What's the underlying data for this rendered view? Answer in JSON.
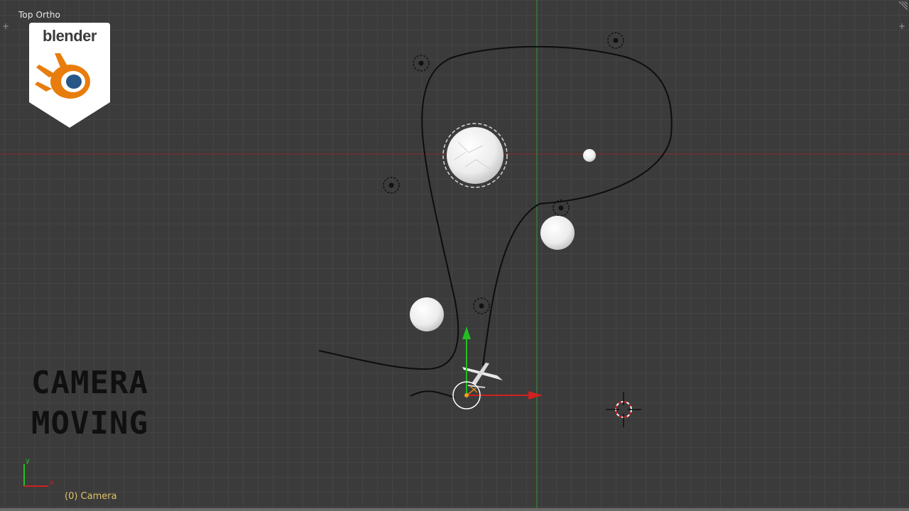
{
  "viewport": {
    "view_label": "Top Ortho",
    "status": "(0) Camera",
    "colors": {
      "background": "#3b3b3b",
      "grid": "#444444",
      "x_axis": "#8a2b2b",
      "y_axis": "#2f9a2f",
      "status_text": "#e0c26a"
    }
  },
  "logo": {
    "text": "blender",
    "colors": {
      "orange": "#e87d0d",
      "blue": "#265787",
      "shield": "#ffffff"
    }
  },
  "overlay": {
    "line1": "CAMERA",
    "line2": "MOVING"
  },
  "axis_widget": {
    "x_label": "x",
    "y_label": "y"
  },
  "icons": {
    "corner_left": "plus-icon",
    "corner_right": "plus-icon",
    "corner_hatch": "hatch-icon",
    "empties": "empty-icon",
    "cursor": "3d-cursor-icon",
    "camera": "camera-icon"
  }
}
